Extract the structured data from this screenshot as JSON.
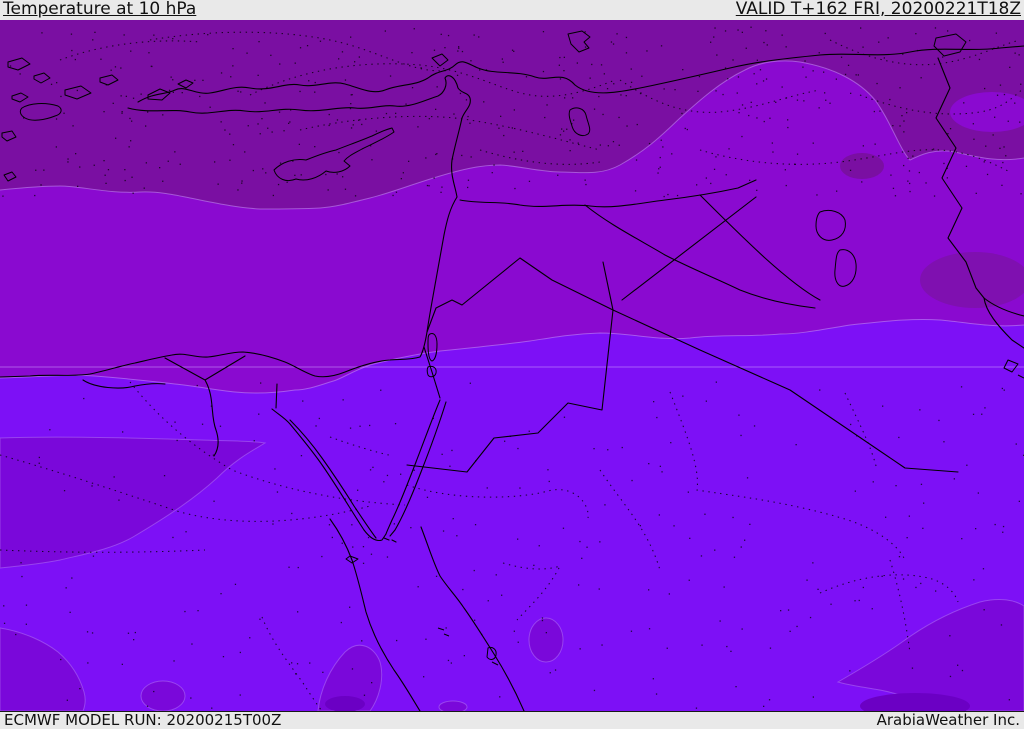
{
  "header": {
    "title": "Temperature at 10 hPa",
    "valid": "VALID T+162 FRI, 20200221T18Z"
  },
  "footer": {
    "model_run": "ECMWF MODEL RUN: 20200215T00Z",
    "brand": "ArabiaWeather Inc."
  },
  "map": {
    "band_colors": {
      "coldest_north": "#7a0fa2",
      "transition_patch": "#7f10b0",
      "cold_band": "#8a0ad0",
      "cool_patch": "#7a08da",
      "warm_south": "#7d10f6",
      "dark_spot": "#6b00c4"
    },
    "coastline_color": "#000000",
    "chrome": {
      "bar_bg": "#e9e9e9",
      "bar_text": "#111111"
    }
  }
}
